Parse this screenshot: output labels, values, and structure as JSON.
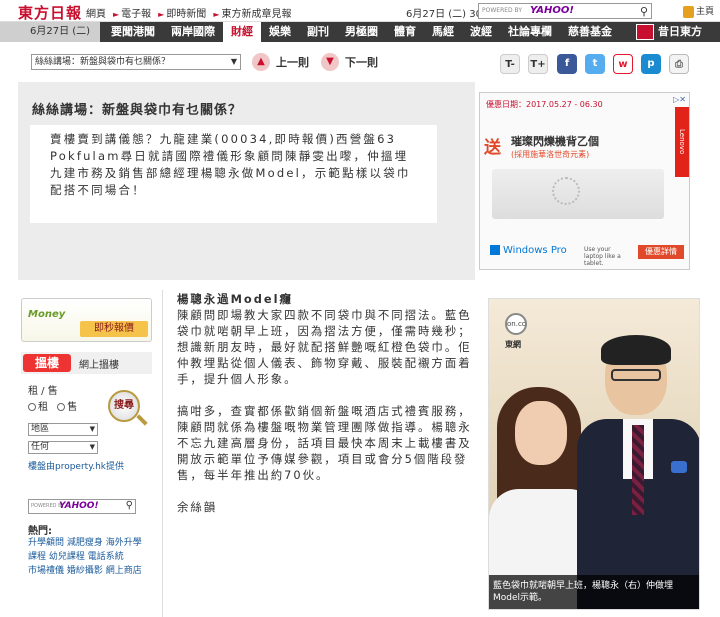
{
  "top": {
    "logo": "東方日報",
    "links": [
      "網頁",
      "電子報",
      "即時新聞",
      "東方新成章見報"
    ],
    "date_weather": "6月27日 (二) 30°C",
    "search_powered": "POWERED BY",
    "search_brand": "YAHOO!",
    "home": "主頁"
  },
  "nav": {
    "date": "6月27日 (二)",
    "items": [
      "要聞港聞",
      "兩岸國際",
      "財經",
      "娛樂",
      "副刊",
      "男極圈",
      "體育",
      "馬經",
      "波經",
      "社論專欄",
      "慈善基金"
    ],
    "active": "財經",
    "last": "昔日東方"
  },
  "toolbar": {
    "article_select": "絲絲講場：新盤與袋巾有乜關係？",
    "prev": "上一則",
    "next": "下一則",
    "font_minus": "T-",
    "font_plus": "T+"
  },
  "summary": {
    "title": "絲絲講場：新盤與袋巾有乜關係？",
    "body": "賣樓賣到講儀態？九龍建業(00034,即時報價)西營盤63 Pokfulam尋日就請國際禮儀形象顧問陳靜雯出嚟，仲搵埋九建市務及銷售部總經理楊聰永做Model，示範點樣以袋巾配搭不同場合！"
  },
  "ad": {
    "date": "優惠日期：2017.05.27 - 06.30",
    "song": "送",
    "line1": "璀璨閃爍機背乙個",
    "line2": "(採用施華洛世奇元素)",
    "brand": "Lenovo",
    "windows": "Windows Pro",
    "tiny": "Use your laptop like a tablet.",
    "detail": "優惠詳情"
  },
  "sidebar": {
    "money_logo": "Money",
    "money_btn": "即秒報價",
    "bulou_logo": "搵樓",
    "bulou_right": "網上搵樓",
    "rent_sell": "租 / 售",
    "rent": "租",
    "sell": "售",
    "district": "地區",
    "any": "任何",
    "search_btn": "搜尋",
    "provider": "樓盤由property.hk提供",
    "search_powered": "POWERED BY",
    "search_brand": "YAHOO!",
    "hot_title": "熱門:",
    "hot_links": [
      "升學顧問",
      "減肥瘦身",
      "海外升學",
      "課程",
      "幼兒課程",
      "電話系統",
      "市場禮儀",
      "婚紗攝影",
      "網上商店"
    ]
  },
  "article": {
    "heading": "楊聰永過Model癮",
    "p1": "陳顧問即場教大家四款不同袋巾與不同摺法。藍色袋巾就啱朝早上班，因為摺法方便，僅需時幾秒；想識新朋友時，最好就配搭鮮艷嘅紅橙色袋巾。佢仲教埋點從個人儀表、飾物穿戴、服裝配襯方面着手，提升個人形象。",
    "p2": "搞咁多，查實都係歡銷個新盤嘅酒店式禮賓服務，陳顧問就係為樓盤嘅物業管理團隊做指導。楊聰永不忘九建高層身份，話項目最快本周末上載樓書及開放示範單位予傳媒參觀，項目或會分5個階段發售，每半年推出約70伙。",
    "author": "余絲韻"
  },
  "photo": {
    "logo": "on.cc",
    "source": "東網",
    "caption": "藍色袋巾就啱朝早上班，楊聰永（右）仲做埋Model示範。"
  }
}
